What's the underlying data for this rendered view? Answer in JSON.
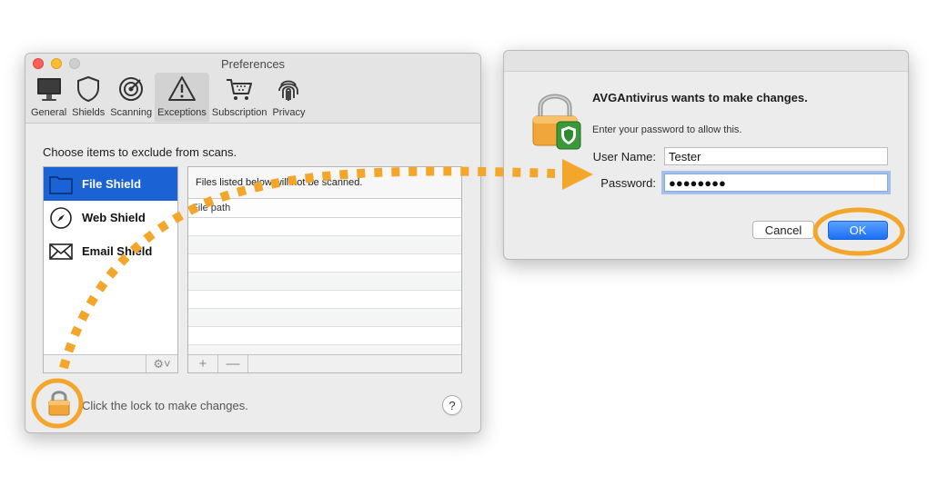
{
  "preferences": {
    "title": "Preferences",
    "toolbar": [
      {
        "label": "General",
        "icon": "monitor-icon"
      },
      {
        "label": "Shields",
        "icon": "shield-icon"
      },
      {
        "label": "Scanning",
        "icon": "radar-icon"
      },
      {
        "label": "Exceptions",
        "icon": "warning-icon",
        "active": true
      },
      {
        "label": "Subscription",
        "icon": "cart-icon"
      },
      {
        "label": "Privacy",
        "icon": "fingerprint-icon"
      }
    ],
    "instruction": "Choose items to exclude from scans.",
    "shields": [
      {
        "label": "File Shield",
        "icon": "folder-icon",
        "selected": true
      },
      {
        "label": "Web Shield",
        "icon": "compass-icon"
      },
      {
        "label": "Email Shield",
        "icon": "envelope-icon"
      }
    ],
    "table": {
      "note": "Files listed below will not be scanned.",
      "column_header": "File path"
    },
    "footer": {
      "add_symbol": "+",
      "remove_symbol": "—",
      "gear_symbol": "⚙˅",
      "lock_message": "Click the lock to make changes.",
      "help_symbol": "?"
    }
  },
  "auth": {
    "title": "AVGAntivirus wants to make changes.",
    "subtitle": "Enter your password to allow this.",
    "username_label": "User Name:",
    "username_value": "Tester",
    "password_label": "Password:",
    "password_value": "●●●●●●●●",
    "cancel_label": "Cancel",
    "ok_label": "OK"
  },
  "colors": {
    "selection_blue": "#1b62d4",
    "ok_blue": "#1a6ff5",
    "annotation_orange": "#f4a62a"
  }
}
